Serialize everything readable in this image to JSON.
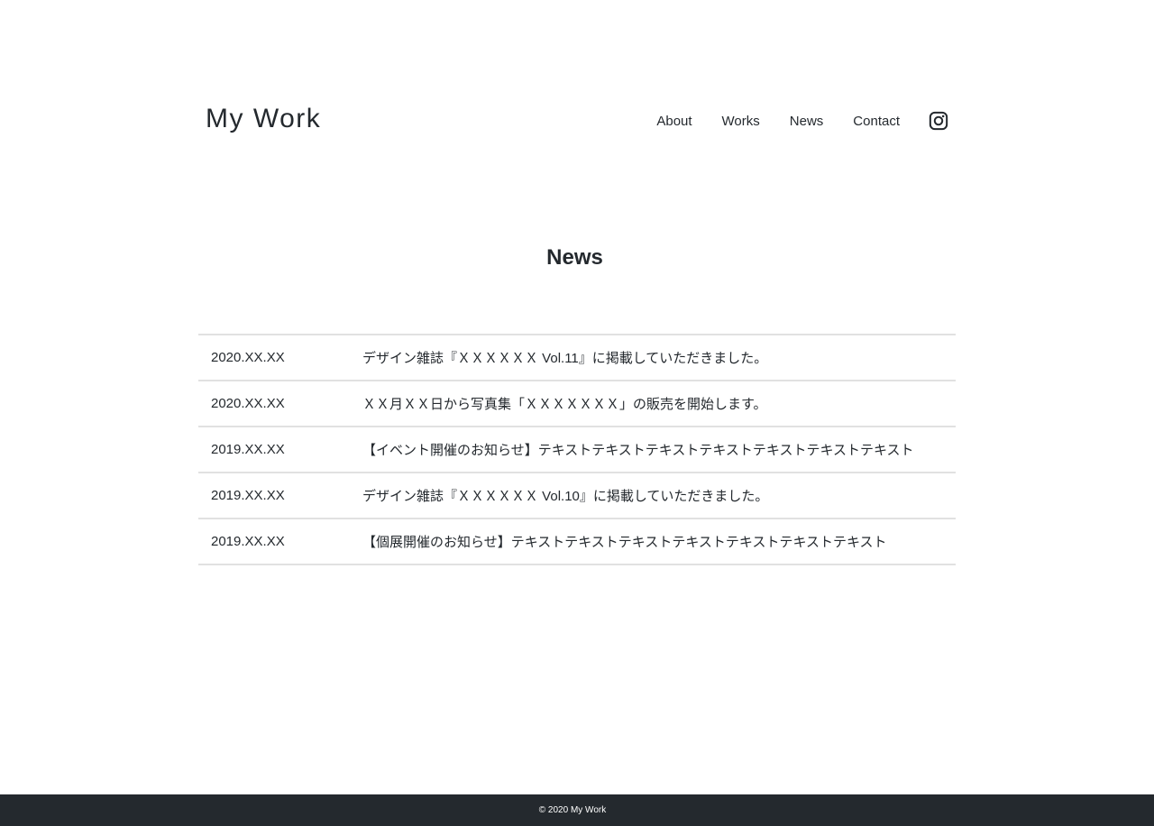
{
  "header": {
    "site_title": "My Work",
    "nav": [
      {
        "label": "About"
      },
      {
        "label": "Works"
      },
      {
        "label": "News"
      },
      {
        "label": "Contact"
      }
    ],
    "social_icon": "instagram-icon"
  },
  "main": {
    "section_title": "News",
    "news": [
      {
        "date": "2020.XX.XX",
        "text": "デザイン雑誌『ＸＸＸＸＸＸ Vol.11』に掲載していただきました。"
      },
      {
        "date": "2020.XX.XX",
        "text": "ＸＸ月ＸＸ日から写真集「ＸＸＸＸＸＸＸ」の販売を開始します。"
      },
      {
        "date": "2019.XX.XX",
        "text": "【イベント開催のお知らせ】テキストテキストテキストテキストテキストテキストテキスト"
      },
      {
        "date": "2019.XX.XX",
        "text": "デザイン雑誌『ＸＸＸＸＸＸ Vol.10』に掲載していただきました。"
      },
      {
        "date": "2019.XX.XX",
        "text": "【個展開催のお知らせ】テキストテキストテキストテキストテキストテキストテキスト"
      }
    ]
  },
  "footer": {
    "copyright": "© 2020 My Work"
  },
  "colors": {
    "text": "#24292e",
    "footer_bg": "#24292e",
    "divider": "#e1e1e1",
    "background": "#ffffff"
  }
}
